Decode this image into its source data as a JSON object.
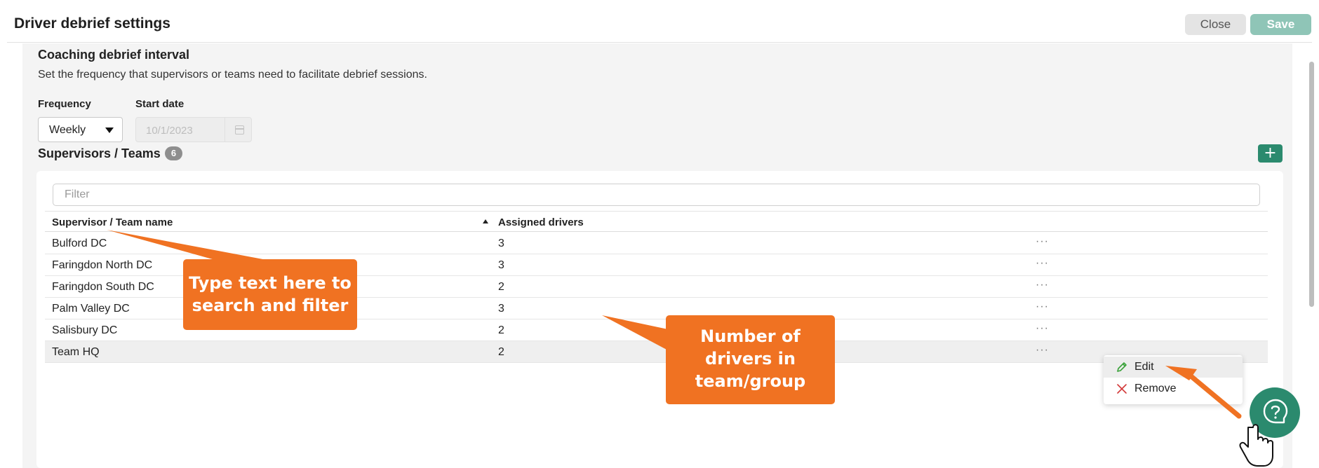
{
  "header": {
    "title": "Driver debrief settings",
    "close_label": "Close",
    "save_label": "Save"
  },
  "interval": {
    "title": "Coaching debrief interval",
    "description": "Set the frequency that supervisors or teams need to facilitate debrief sessions.",
    "frequency_label": "Frequency",
    "frequency_value": "Weekly",
    "start_date_label": "Start date",
    "start_date_value": "10/1/2023"
  },
  "teams": {
    "title": "Supervisors / Teams",
    "count": "6",
    "add_label": "+",
    "filter_placeholder": "Filter",
    "columns": {
      "name": "Supervisor / Team name",
      "assigned": "Assigned drivers"
    },
    "more_label": "···",
    "rows": [
      {
        "name": "Bulford DC",
        "assigned": "3"
      },
      {
        "name": "Faringdon North DC",
        "assigned": "3"
      },
      {
        "name": "Faringdon South DC",
        "assigned": "2"
      },
      {
        "name": "Palm Valley DC",
        "assigned": "3"
      },
      {
        "name": "Salisbury DC",
        "assigned": "2"
      },
      {
        "name": "Team HQ",
        "assigned": "2"
      }
    ]
  },
  "context_menu": {
    "edit_label": "Edit",
    "remove_label": "Remove"
  },
  "annotations": {
    "filter_hint_line1": "Type text here to",
    "filter_hint_line2": "search and filter",
    "drivers_hint_line1": "Number of",
    "drivers_hint_line2": "drivers in",
    "drivers_hint_line3": "team/group"
  },
  "colors": {
    "brand": "#2b8a6e",
    "save_disabled": "#8fc5b7",
    "callout": "#f07222"
  }
}
